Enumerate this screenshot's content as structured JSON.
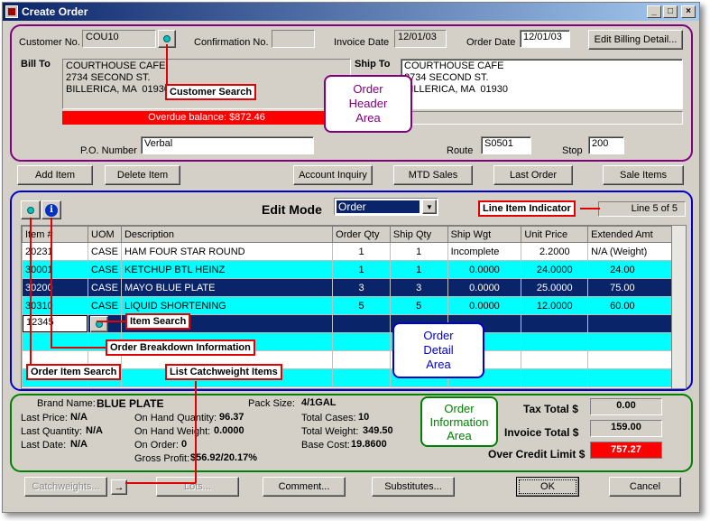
{
  "window": {
    "title": "Create Order"
  },
  "header": {
    "customer_no_label": "Customer No.",
    "customer_no_value": "COU10",
    "confirmation_no_label": "Confirmation No.",
    "confirmation_no_value": "",
    "invoice_date_label": "Invoice Date",
    "invoice_date_value": "12/01/03",
    "order_date_label": "Order Date",
    "order_date_value": "12/01/03",
    "edit_billing_button": "Edit Billing Detail...",
    "bill_to_label": "Bill To",
    "bill_to_value": "COURTHOUSE CAFE\n2734 SECOND ST.\nBILLERICA, MA  01930",
    "ship_to_label": "Ship To",
    "ship_to_value": "COURTHOUSE CAFE\n2734 SECOND ST.\nBILLERICA, MA  01930",
    "overdue_text": "Overdue balance: $872.46",
    "po_label": "P.O. Number",
    "po_value": "Verbal",
    "route_label": "Route",
    "route_value": "S0501",
    "stop_label": "Stop",
    "stop_value": "200"
  },
  "toolbar": {
    "add_item": "Add Item",
    "delete_item": "Delete Item",
    "account_inquiry": "Account Inquiry",
    "mtd_sales": "MTD Sales",
    "last_order": "Last Order",
    "sale_items": "Sale Items"
  },
  "detail": {
    "edit_mode_label": "Edit Mode",
    "edit_mode_value": "Order",
    "line_indicator": "Line 5 of 5",
    "columns": [
      "Item #",
      "UOM",
      "Description",
      "Order Qty",
      "Ship Qty",
      "Ship Wgt",
      "Unit Price",
      "Extended Amt"
    ],
    "rows": [
      [
        "20231",
        "CASE",
        "HAM FOUR STAR ROUND",
        "1",
        "1",
        "Incomplete",
        "2.2000",
        "N/A (Weight)"
      ],
      [
        "30001",
        "CASE",
        "KETCHUP BTL HEINZ",
        "1",
        "1",
        "0.0000",
        "24.0000",
        "24.00"
      ],
      [
        "30200",
        "CASE",
        "MAYO BLUE PLATE",
        "3",
        "3",
        "0.0000",
        "25.0000",
        "75.00"
      ],
      [
        "30310",
        "CASE",
        "LIQUID SHORTENING",
        "5",
        "5",
        "0.0000",
        "12.0000",
        "60.00"
      ]
    ],
    "new_item_value": "12345"
  },
  "info": {
    "brand_name_label": "Brand Name:",
    "brand_name_value": "BLUE PLATE",
    "pack_size_label": "Pack Size:",
    "pack_size_value": "4/1GAL",
    "last_price_label": "Last Price:",
    "last_price_value": "N/A",
    "last_quantity_label": "Last Quantity:",
    "last_quantity_value": "N/A",
    "last_date_label": "Last Date:",
    "last_date_value": "N/A",
    "on_hand_qty_label": "On Hand Quantity:",
    "on_hand_qty_value": "96.37",
    "on_hand_wgt_label": "On Hand Weight:",
    "on_hand_wgt_value": "0.0000",
    "on_order_label": "On Order:",
    "on_order_value": "0",
    "gross_profit_label": "Gross Profit:",
    "gross_profit_value": "$56.92/20.17%",
    "total_cases_label": "Total Cases:",
    "total_cases_value": "10",
    "total_weight_label": "Total Weight:",
    "total_weight_value": "349.50",
    "base_cost_label": "Base Cost:",
    "base_cost_value": "19.8600",
    "tax_total_label": "Tax Total $",
    "tax_total_value": "0.00",
    "invoice_total_label": "Invoice Total $",
    "invoice_total_value": "159.00",
    "over_credit_label": "Over Credit Limit $",
    "over_credit_value": "757.27"
  },
  "bottom": {
    "catchweights": "Catchweights...",
    "lots": "Lots...",
    "comment": "Comment...",
    "substitutes": "Substitutes...",
    "ok": "OK",
    "cancel": "Cancel"
  },
  "annotations": {
    "customer_search": "Customer Search",
    "order_header_area": "Order Header Area",
    "line_item_indicator": "Line Item Indicator",
    "item_search": "Item Search",
    "order_breakdown": "Order Breakdown Information",
    "order_item_search": "Order Item Search",
    "list_catchweight": "List Catchweight Items",
    "order_detail_area": "Order Detail Area",
    "order_information_area": "Order Information Area"
  },
  "colors": {
    "title_start": "#0a246a",
    "title_end": "#a6caf0",
    "header_border": "#800080",
    "detail_border": "#0000cc",
    "info_border": "#008000",
    "row_highlight": "#00ffff",
    "row_selected": "#0a246a",
    "overdue_bg": "#ff0000",
    "callout_border": "#e00000"
  }
}
